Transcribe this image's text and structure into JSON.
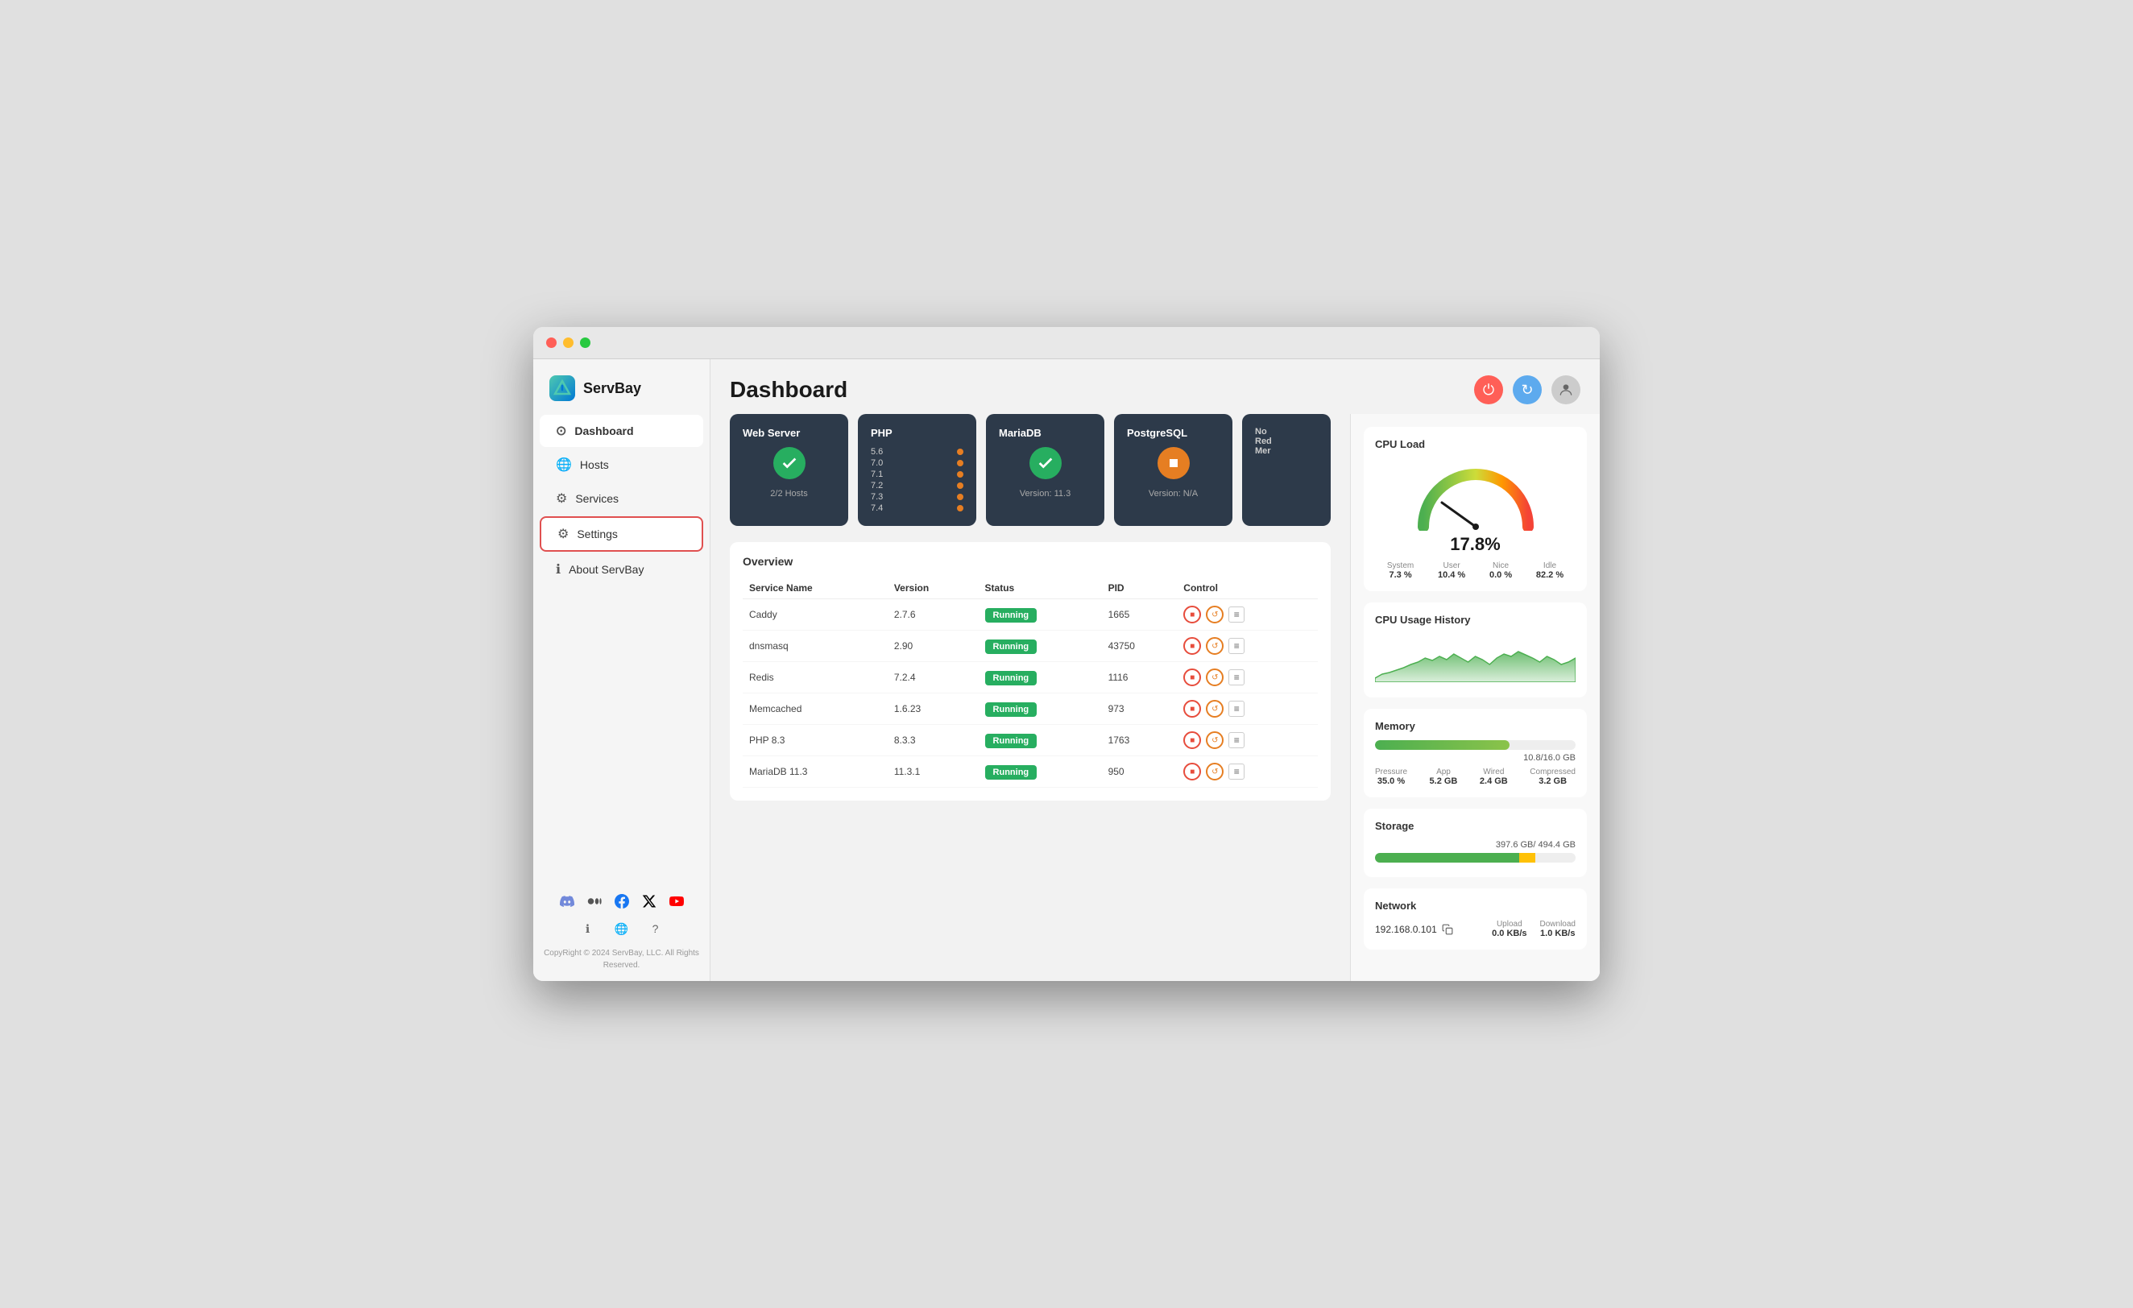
{
  "window": {
    "title": "ServBay"
  },
  "sidebar": {
    "logo": "ServBay",
    "nav_items": [
      {
        "id": "dashboard",
        "label": "Dashboard",
        "icon": "⊙",
        "active": true
      },
      {
        "id": "hosts",
        "label": "Hosts",
        "icon": "🌐",
        "active": false
      },
      {
        "id": "services",
        "label": "Services",
        "icon": "⚙",
        "active": false
      },
      {
        "id": "settings",
        "label": "Settings",
        "icon": "⚙",
        "active": false,
        "selected": true
      },
      {
        "id": "about",
        "label": "About ServBay",
        "icon": "ℹ",
        "active": false
      }
    ],
    "social_icons": [
      "discord",
      "medium",
      "facebook",
      "twitter",
      "youtube"
    ],
    "extra_icons": [
      "info",
      "globe",
      "help"
    ],
    "copyright": "CopyRight © 2024 ServBay, LLC.\nAll Rights Reserved."
  },
  "header": {
    "title": "Dashboard",
    "buttons": {
      "power": "⏻",
      "refresh": "↻",
      "user": "👤"
    }
  },
  "service_cards": [
    {
      "id": "webserver",
      "title": "Web Server",
      "status": "ok",
      "subtitle": "2/2 Hosts",
      "type": "check"
    },
    {
      "id": "php",
      "title": "PHP",
      "type": "versions",
      "versions": [
        "5.6",
        "7.0",
        "7.1",
        "7.2",
        "7.3",
        "7.4"
      ]
    },
    {
      "id": "mariadb",
      "title": "MariaDB",
      "status": "ok",
      "subtitle": "Version: 11.3",
      "type": "check"
    },
    {
      "id": "postgresql",
      "title": "PostgreSQL",
      "status": "warning",
      "subtitle": "Version: N/A",
      "type": "stop"
    },
    {
      "id": "other",
      "title": "No",
      "lines": [
        "Red",
        "Mer"
      ],
      "type": "partial"
    }
  ],
  "overview": {
    "title": "Overview",
    "table_headers": [
      "Service Name",
      "Version",
      "Status",
      "PID",
      "Control"
    ],
    "rows": [
      {
        "name": "Caddy",
        "version": "2.7.6",
        "status": "Running",
        "pid": "1665"
      },
      {
        "name": "dnsmasq",
        "version": "2.90",
        "status": "Running",
        "pid": "43750"
      },
      {
        "name": "Redis",
        "version": "7.2.4",
        "status": "Running",
        "pid": "1116"
      },
      {
        "name": "Memcached",
        "version": "1.6.23",
        "status": "Running",
        "pid": "973"
      },
      {
        "name": "PHP 8.3",
        "version": "8.3.3",
        "status": "Running",
        "pid": "1763"
      },
      {
        "name": "MariaDB 11.3",
        "version": "11.3.1",
        "status": "Running",
        "pid": "950"
      }
    ]
  },
  "right_panel": {
    "cpu_load": {
      "title": "CPU Load",
      "value": "17.8%",
      "stats": [
        {
          "label": "System",
          "value": "7.3 %"
        },
        {
          "label": "User",
          "value": "10.4 %"
        },
        {
          "label": "Nice",
          "value": "0.0 %"
        },
        {
          "label": "Idle",
          "value": "82.2 %"
        }
      ]
    },
    "cpu_history": {
      "title": "CPU Usage History"
    },
    "memory": {
      "title": "Memory",
      "total": "10.8/16.0 GB",
      "fill_percent": 67,
      "stats": [
        {
          "label": "Pressure",
          "value": "35.0 %"
        },
        {
          "label": "App",
          "value": "5.2 GB"
        },
        {
          "label": "Wired",
          "value": "2.4 GB"
        },
        {
          "label": "Compressed",
          "value": "3.2 GB"
        }
      ]
    },
    "storage": {
      "title": "Storage",
      "total": "397.6 GB/ 494.4 GB",
      "green_percent": 72,
      "yellow_percent": 8
    },
    "network": {
      "title": "Network",
      "ip": "192.168.0.101",
      "upload_label": "Upload",
      "upload_value": "0.0 KB/s",
      "download_label": "Download",
      "download_value": "1.0 KB/s"
    }
  }
}
